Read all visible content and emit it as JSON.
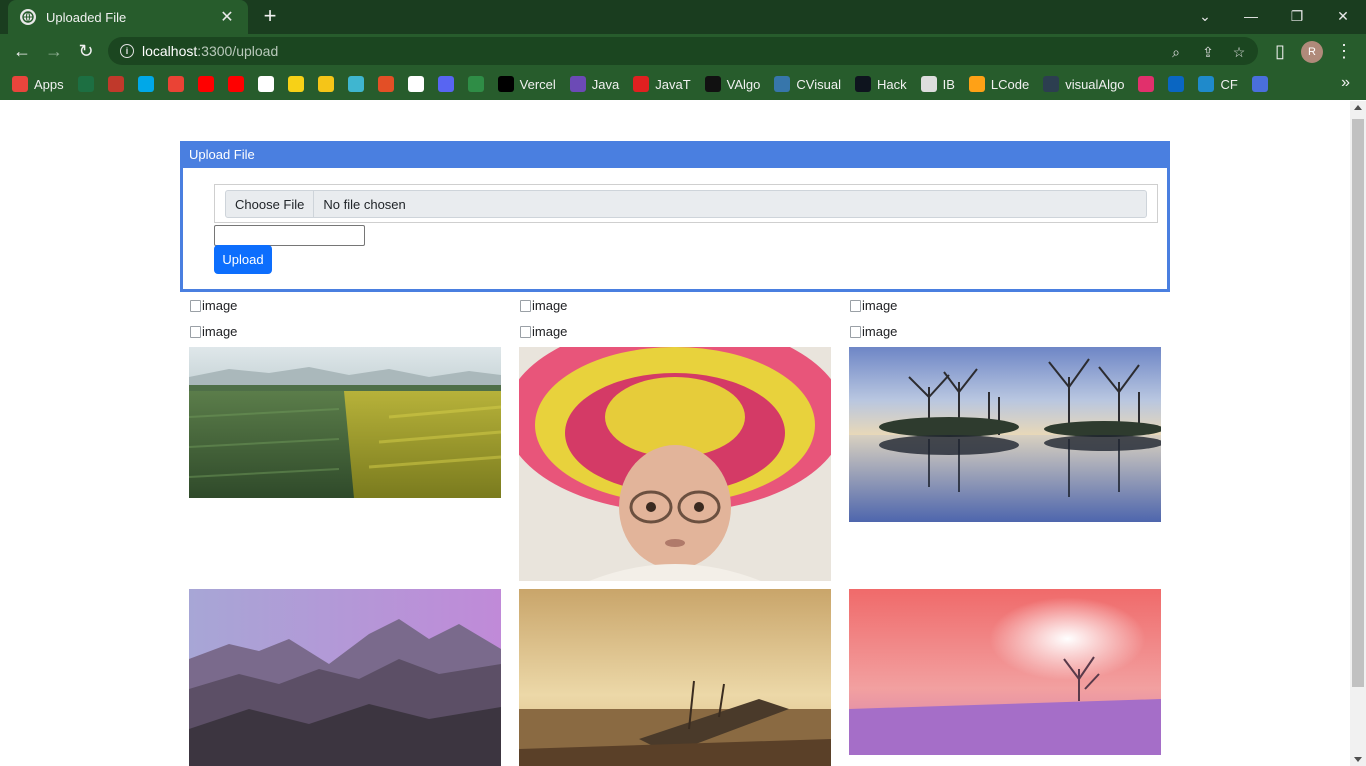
{
  "browser": {
    "tab": {
      "title": "Uploaded File"
    },
    "address": {
      "host": "localhost",
      "rest": ":3300/upload"
    },
    "profile_initial": "R",
    "bookmarks": [
      {
        "label": "Apps",
        "icon": "apps-grid-icon",
        "color": "#e8453c"
      },
      {
        "label": "",
        "icon": "excel-icon",
        "color": "#1d6f42"
      },
      {
        "label": "",
        "icon": "speed-icon",
        "color": "#c0392b"
      },
      {
        "label": "",
        "icon": "p-icon",
        "color": "#00a8e8"
      },
      {
        "label": "",
        "icon": "gmail-icon",
        "color": "#ea4335"
      },
      {
        "label": "",
        "icon": "youtube-icon",
        "color": "#ff0000"
      },
      {
        "label": "",
        "icon": "youtube-music-icon",
        "color": "#ff0000"
      },
      {
        "label": "",
        "icon": "amazon-icon",
        "color": "#ffffff"
      },
      {
        "label": "",
        "icon": "flipkart-icon",
        "color": "#f7d117"
      },
      {
        "label": "",
        "icon": "pratilipi-icon",
        "color": "#f5c518"
      },
      {
        "label": "",
        "icon": "arrow-icon",
        "color": "#3fb6d0"
      },
      {
        "label": "",
        "icon": "code-icon",
        "color": "#e34f26"
      },
      {
        "label": "",
        "icon": "github-icon",
        "color": "#ffffff"
      },
      {
        "label": "",
        "icon": "discord-icon",
        "color": "#5865f2"
      },
      {
        "label": "",
        "icon": "gfg-icon",
        "color": "#2f8d46"
      },
      {
        "label": "Vercel",
        "icon": "vercel-icon",
        "color": "#000000"
      },
      {
        "label": "Java",
        "icon": "bolt-icon",
        "color": "#6c4ab6"
      },
      {
        "label": "JavaT",
        "icon": "javat-icon",
        "color": "#e02020"
      },
      {
        "label": "VAlgo",
        "icon": "valgo-icon",
        "color": "#111111"
      },
      {
        "label": "CVisual",
        "icon": "python-icon",
        "color": "#3776ab"
      },
      {
        "label": "Hack",
        "icon": "hack-icon",
        "color": "#0e141e"
      },
      {
        "label": "IB",
        "icon": "ib-icon",
        "color": "#dddddd"
      },
      {
        "label": "LCode",
        "icon": "leetcode-icon",
        "color": "#ffa116"
      },
      {
        "label": "visualAlgo",
        "icon": "visualalgo-icon",
        "color": "#2c3e50"
      },
      {
        "label": "",
        "icon": "instagram-icon",
        "color": "#e1306c"
      },
      {
        "label": "",
        "icon": "linkedin-icon",
        "color": "#0a66c2"
      },
      {
        "label": "CF",
        "icon": "codeforces-icon",
        "color": "#1f8acb"
      },
      {
        "label": "",
        "icon": "link-icon",
        "color": "#4a6fdc"
      }
    ]
  },
  "upload_card": {
    "header": "Upload File",
    "file_button": "Choose File",
    "file_status": "No file chosen",
    "text_value": "",
    "upload_button": "Upload"
  },
  "broken_images": [
    {
      "alt": "image"
    },
    {
      "alt": "image"
    },
    {
      "alt": "image"
    },
    {
      "alt": "image"
    },
    {
      "alt": "image"
    },
    {
      "alt": "image"
    }
  ],
  "photos": [
    {
      "subject": "green and yellow flower field"
    },
    {
      "subject": "elderly woman in sombrero"
    },
    {
      "subject": "trees reflected in lake at dusk"
    },
    {
      "subject": "purple mountain range"
    },
    {
      "subject": "shipwrecked boat on shore"
    },
    {
      "subject": "pink sunset over snowy field"
    }
  ]
}
